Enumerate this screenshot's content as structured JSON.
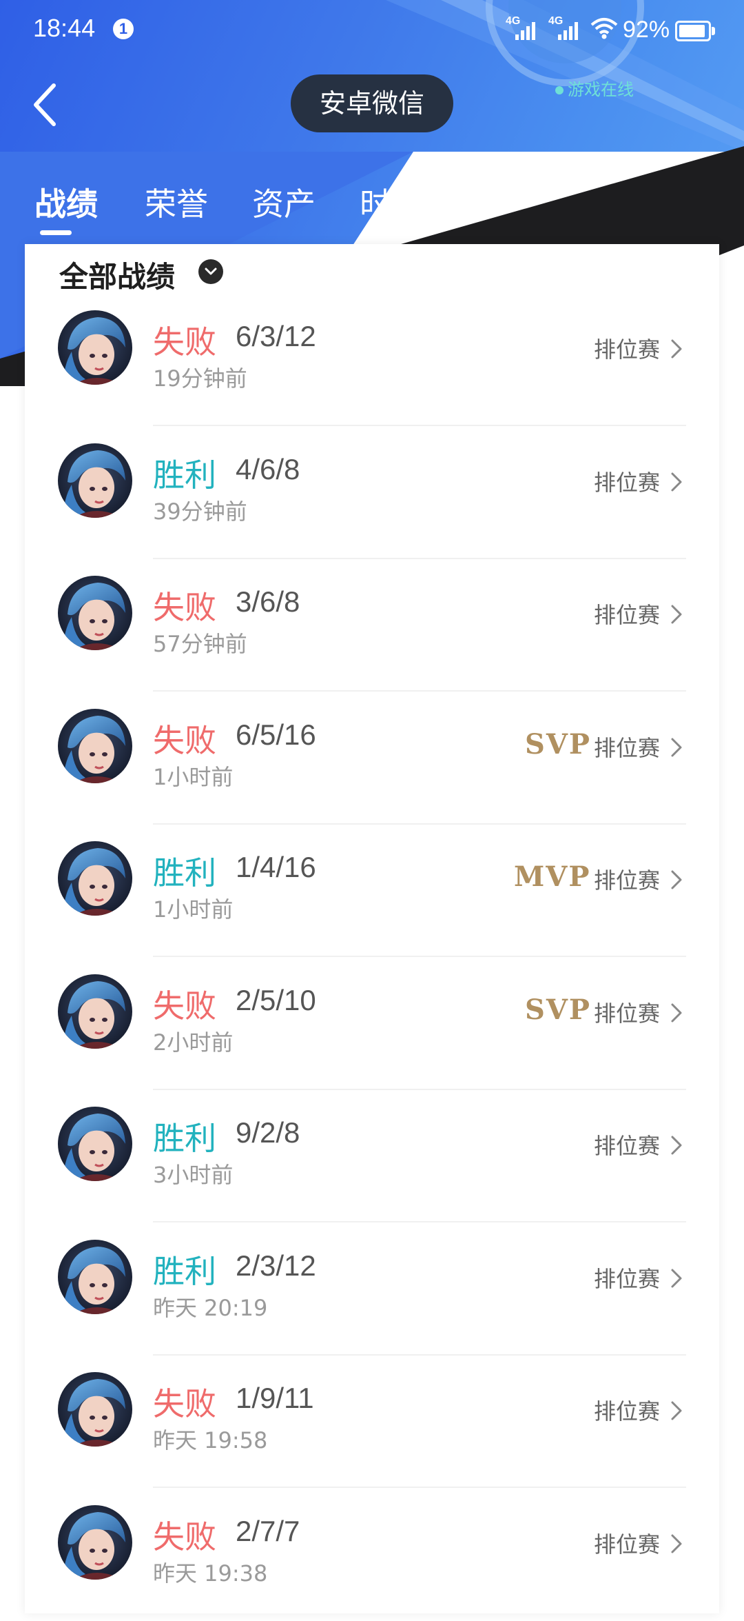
{
  "status_bar": {
    "time": "18:44",
    "notification_count": "1",
    "network1": "4G",
    "network2": "4G",
    "battery": "92%",
    "battery_level": 0.92
  },
  "header": {
    "title": "安卓微信",
    "online_status": "游戏在线"
  },
  "tabs": [
    {
      "label": "战绩",
      "active": true
    },
    {
      "label": "荣誉",
      "active": false
    },
    {
      "label": "资产",
      "active": false
    },
    {
      "label": "时刻",
      "active": false
    }
  ],
  "filter": {
    "label": "全部战绩"
  },
  "matches": [
    {
      "result": "失败",
      "outcome": "lose",
      "kda": "6/3/12",
      "time": "19分钟前",
      "badge": "",
      "mode": "排位赛"
    },
    {
      "result": "胜利",
      "outcome": "win",
      "kda": "4/6/8",
      "time": "39分钟前",
      "badge": "",
      "mode": "排位赛"
    },
    {
      "result": "失败",
      "outcome": "lose",
      "kda": "3/6/8",
      "time": "57分钟前",
      "badge": "",
      "mode": "排位赛"
    },
    {
      "result": "失败",
      "outcome": "lose",
      "kda": "6/5/16",
      "time": "1小时前",
      "badge": "SVP",
      "mode": "排位赛"
    },
    {
      "result": "胜利",
      "outcome": "win",
      "kda": "1/4/16",
      "time": "1小时前",
      "badge": "MVP",
      "mode": "排位赛"
    },
    {
      "result": "失败",
      "outcome": "lose",
      "kda": "2/5/10",
      "time": "2小时前",
      "badge": "SVP",
      "mode": "排位赛"
    },
    {
      "result": "胜利",
      "outcome": "win",
      "kda": "9/2/8",
      "time": "3小时前",
      "badge": "",
      "mode": "排位赛"
    },
    {
      "result": "胜利",
      "outcome": "win",
      "kda": "2/3/12",
      "time": "昨天 20:19",
      "badge": "",
      "mode": "排位赛"
    },
    {
      "result": "失败",
      "outcome": "lose",
      "kda": "1/9/11",
      "time": "昨天 19:58",
      "badge": "",
      "mode": "排位赛"
    },
    {
      "result": "失败",
      "outcome": "lose",
      "kda": "2/7/7",
      "time": "昨天 19:38",
      "badge": "",
      "mode": "排位赛"
    }
  ],
  "colors": {
    "lose": "#ef6b6b",
    "win": "#22b2be",
    "badge_gold": "#b09060",
    "header_blue": "#3f78ea",
    "title_pill": "#263142"
  }
}
